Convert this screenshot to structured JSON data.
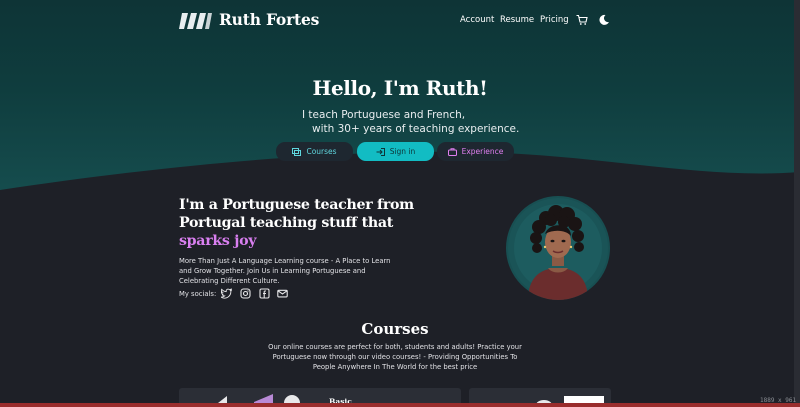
{
  "nav": {
    "brand": "Ruth Fortes",
    "links": [
      "Account",
      "Resume",
      "Pricing"
    ],
    "icons": [
      "cart-icon",
      "moon-icon"
    ]
  },
  "hero": {
    "title": "Hello, I'm Ruth!",
    "subtitle_line1": "I teach Portuguese and French,",
    "subtitle_line2": "with 30+ years of teaching experience.",
    "buttons": [
      {
        "label": "Courses",
        "icon": "courses-icon",
        "color": "#5fd6de"
      },
      {
        "label": "Sign in",
        "icon": "sign-in-icon",
        "color": "#0d3437"
      },
      {
        "label": "Experience",
        "icon": "briefcase-icon",
        "color": "#e07ff0"
      }
    ]
  },
  "about": {
    "title": "I'm a Portuguese teacher from Portugal teaching stuff that",
    "accent": "sparks joy",
    "accent_color": "#d97ff0",
    "description": "More Than Just A Language Learning course - A Place to Learn and Grow Together. Join Us in Learning Portuguese and Celebrating Different Culture.",
    "socials_label": "My socials:",
    "socials": [
      "twitter-icon",
      "instagram-icon",
      "facebook-icon",
      "email-icon"
    ]
  },
  "courses": {
    "title": "Courses",
    "description": "Our online courses are perfect for both, students and adults! Practice your Portuguese now through our video courses! - Providing Opportunities To People Anywhere In The World for the best price",
    "card_label": "Basic"
  },
  "viewport_label": "1889 x 961"
}
